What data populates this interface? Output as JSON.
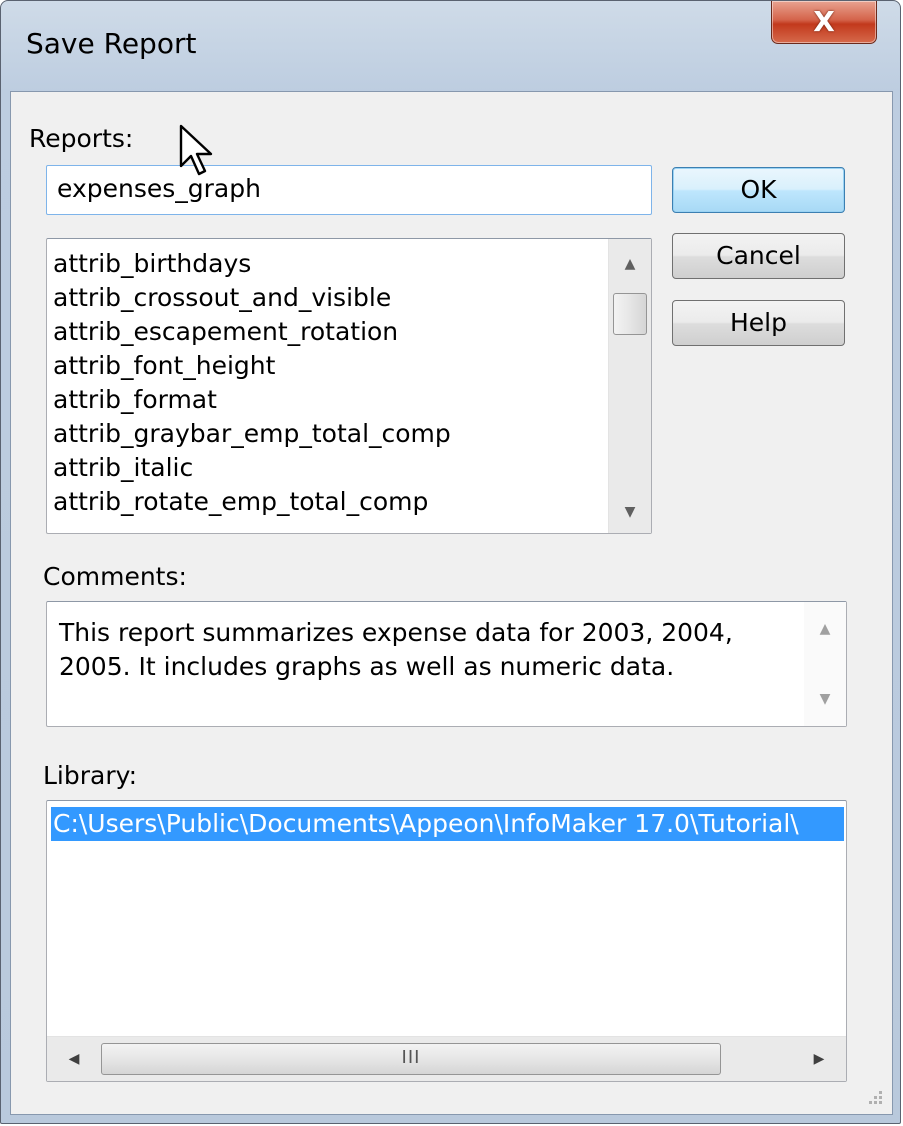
{
  "window": {
    "title": "Save Report",
    "close_glyph": "X"
  },
  "reports": {
    "label": "Reports:",
    "input_value": "expenses_graph",
    "items": [
      "attrib_birthdays",
      "attrib_crossout_and_visible",
      "attrib_escapement_rotation",
      "attrib_font_height",
      "attrib_format",
      "attrib_graybar_emp_total_comp",
      "attrib_italic",
      "attrib_rotate_emp_total_comp"
    ]
  },
  "buttons": {
    "ok": "OK",
    "cancel": "Cancel",
    "help": "Help"
  },
  "comments": {
    "label": "Comments:",
    "text": "This report summarizes expense data for 2003, 2004, 2005. It includes graphs as well as numeric data."
  },
  "library": {
    "label": "Library:",
    "selected_path": "C:\\Users\\Public\\Documents\\Appeon\\InfoMaker 17.0\\Tutorial\\",
    "hscroll_grip": "III"
  },
  "icons": {
    "close": "close-icon",
    "scroll_up": "scroll-up-arrow-icon",
    "scroll_down": "scroll-down-arrow-icon",
    "scroll_left": "scroll-left-arrow-icon",
    "scroll_right": "scroll-right-arrow-icon",
    "cursor": "mouse-pointer-icon",
    "size_grip": "resize-grip-icon"
  },
  "colors": {
    "selection": "#3399ff",
    "default_button_border": "#3c7fb1",
    "close_button": "#c2391c"
  }
}
